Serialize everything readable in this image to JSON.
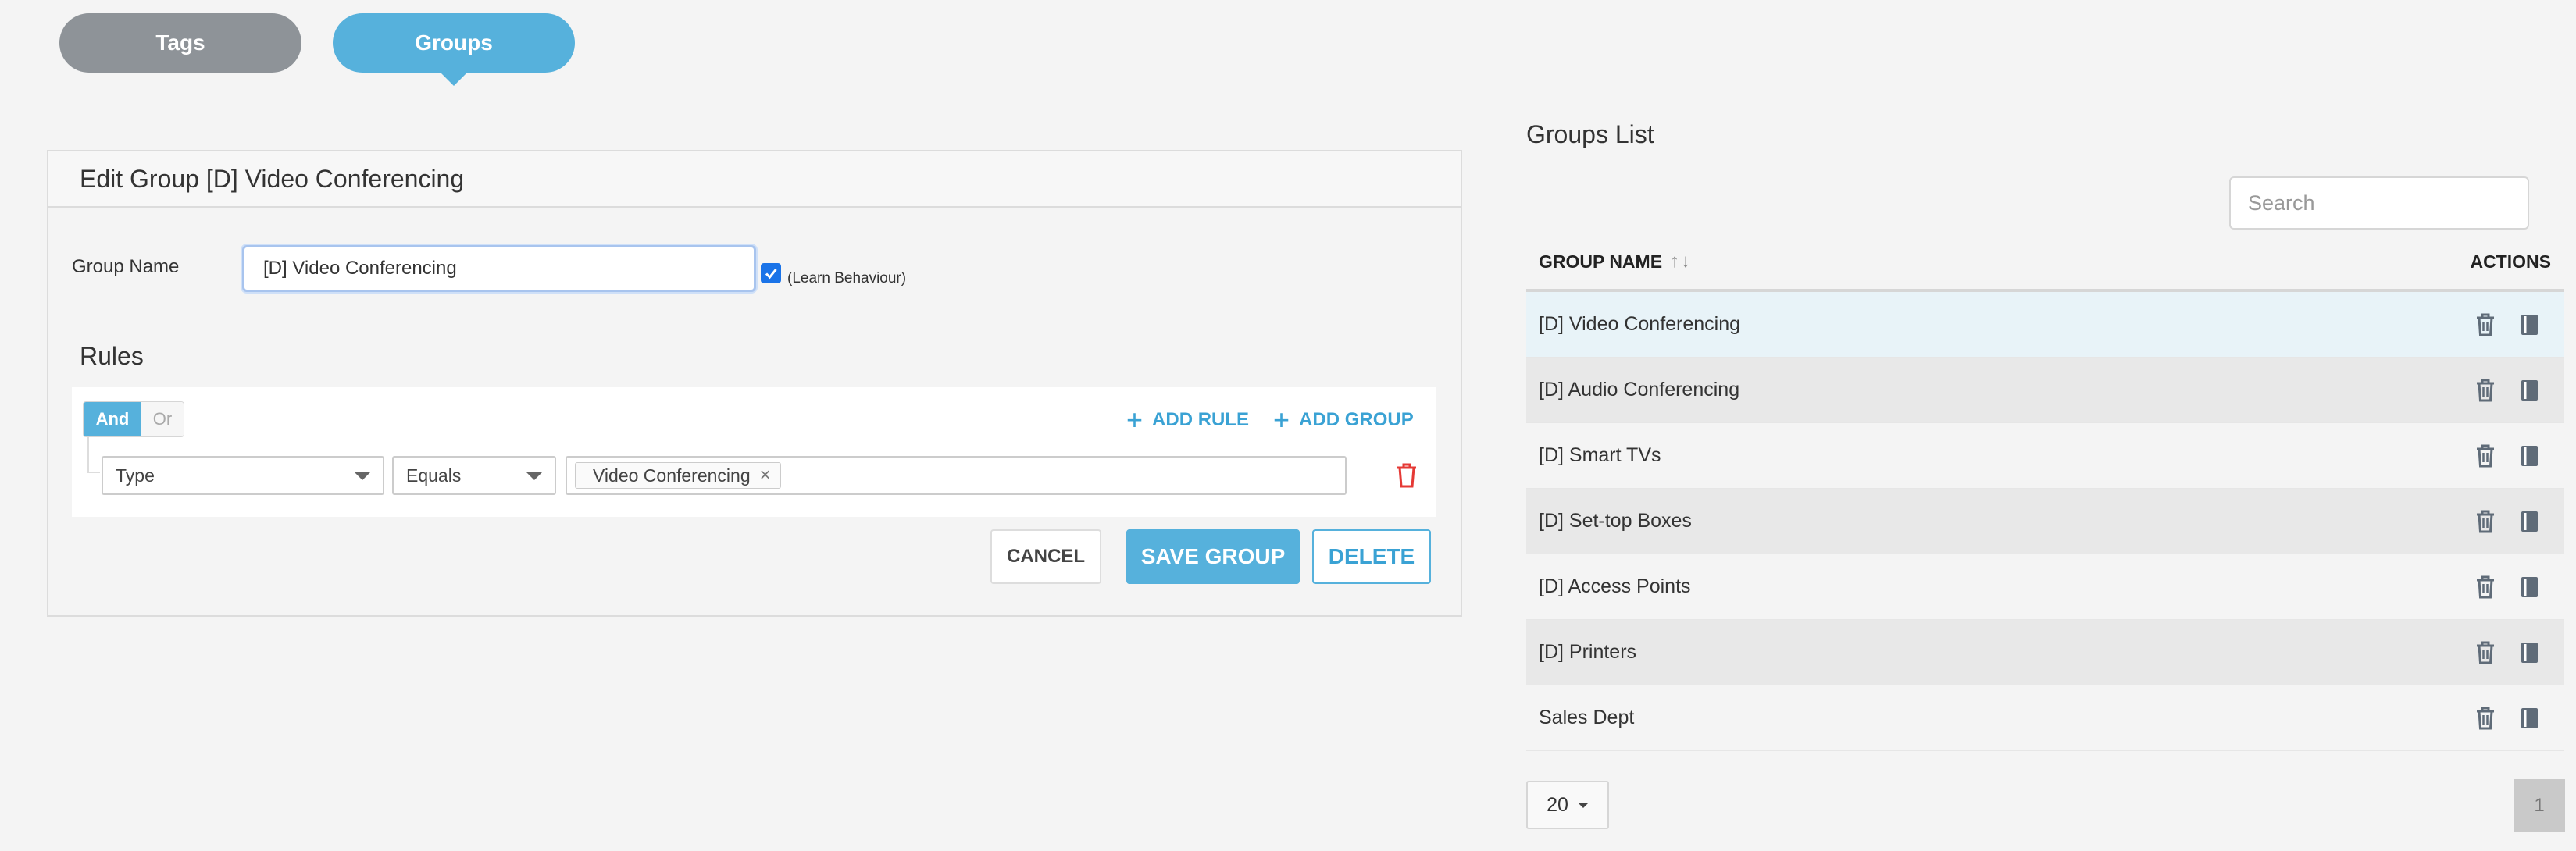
{
  "tabs": {
    "tags": "Tags",
    "groups": "Groups"
  },
  "edit": {
    "title": "Edit Group [D] Video Conferencing",
    "group_name_label": "Group Name",
    "group_name_value": "[D] Video Conferencing",
    "learn_label": "(Learn Behaviour)",
    "learn_checked": true,
    "rules_title": "Rules",
    "and_label": "And",
    "or_label": "Or",
    "add_rule": "ADD RULE",
    "add_group": "ADD GROUP",
    "rule": {
      "field": "Type",
      "operator": "Equals",
      "values": [
        "Video Conferencing"
      ]
    },
    "cancel": "CANCEL",
    "save": "SAVE GROUP",
    "delete": "DELETE"
  },
  "groups_list": {
    "title": "Groups List",
    "search_placeholder": "Search",
    "col_name": "GROUP NAME",
    "sort_icon": "↑↓",
    "col_actions": "ACTIONS",
    "rows": [
      {
        "name": "[D] Video Conferencing"
      },
      {
        "name": "[D] Audio Conferencing"
      },
      {
        "name": "[D] Smart TVs"
      },
      {
        "name": "[D] Set-top Boxes"
      },
      {
        "name": "[D] Access Points"
      },
      {
        "name": "[D] Printers"
      },
      {
        "name": "Sales Dept"
      }
    ],
    "page_size": "20",
    "page": "1"
  },
  "colors": {
    "accent": "#56b1dc",
    "tab_inactive": "#8e9398",
    "danger": "#e53935"
  }
}
